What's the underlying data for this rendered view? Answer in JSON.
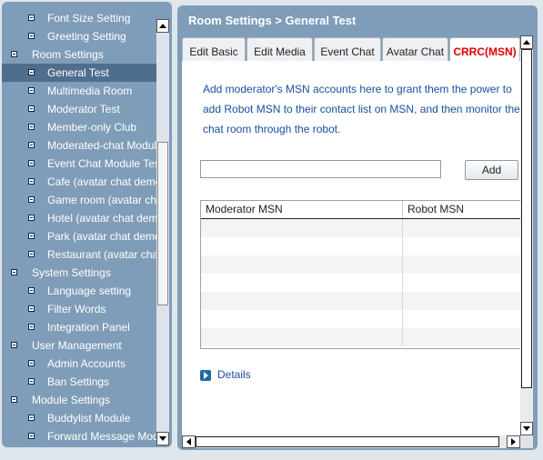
{
  "left_tree": {
    "items": [
      {
        "label": "Font Size Setting",
        "level": 1,
        "selected": false
      },
      {
        "label": "Greeting Setting",
        "level": 1,
        "selected": false
      },
      {
        "label": "Room Settings",
        "level": 0,
        "selected": false
      },
      {
        "label": "General Test",
        "level": 1,
        "selected": true
      },
      {
        "label": "Multimedia Room",
        "level": 1,
        "selected": false
      },
      {
        "label": "Moderator Test",
        "level": 1,
        "selected": false
      },
      {
        "label": "Member-only Club",
        "level": 1,
        "selected": false
      },
      {
        "label": "Moderated-chat Module",
        "level": 1,
        "selected": false
      },
      {
        "label": "Event Chat Module Test",
        "level": 1,
        "selected": false
      },
      {
        "label": "Cafe (avatar chat demo)",
        "level": 1,
        "selected": false
      },
      {
        "label": "Game room (avatar chat demo)",
        "level": 1,
        "selected": false
      },
      {
        "label": "Hotel (avatar chat demo)",
        "level": 1,
        "selected": false
      },
      {
        "label": "Park (avatar chat demo)",
        "level": 1,
        "selected": false
      },
      {
        "label": "Restaurant (avatar chat demo)",
        "level": 1,
        "selected": false
      },
      {
        "label": "System Settings",
        "level": 0,
        "selected": false
      },
      {
        "label": "Language setting",
        "level": 1,
        "selected": false
      },
      {
        "label": "Filter Words",
        "level": 1,
        "selected": false
      },
      {
        "label": "Integration Panel",
        "level": 1,
        "selected": false
      },
      {
        "label": "User Management",
        "level": 0,
        "selected": false
      },
      {
        "label": "Admin Accounts",
        "level": 1,
        "selected": false
      },
      {
        "label": "Ban Settings",
        "level": 1,
        "selected": false
      },
      {
        "label": "Module Settings",
        "level": 0,
        "selected": false
      },
      {
        "label": "Buddylist Module",
        "level": 1,
        "selected": false
      },
      {
        "label": "Forward Message Module",
        "level": 1,
        "selected": false
      }
    ]
  },
  "panel": {
    "title": "Room Settings > General Test"
  },
  "tabs": [
    {
      "label": "Edit Basic",
      "active": false
    },
    {
      "label": "Edit Media",
      "active": false
    },
    {
      "label": "Event Chat",
      "active": false
    },
    {
      "label": "Avatar Chat",
      "active": false
    },
    {
      "label": "CRRC(MSN)",
      "active": true
    }
  ],
  "content": {
    "description_lines": [
      "Add moderator's MSN accounts here to grant them the power to",
      "add Robot MSN to their contact list on MSN, and then monitor the",
      "chat room through the robot."
    ],
    "input_value": "",
    "add_button_label": "Add",
    "table": {
      "columns": [
        "Moderator MSN",
        "Robot MSN"
      ],
      "rows": [
        [
          "",
          ""
        ],
        [
          "",
          ""
        ],
        [
          "",
          ""
        ],
        [
          "",
          ""
        ],
        [
          "",
          ""
        ],
        [
          "",
          ""
        ],
        [
          "",
          ""
        ]
      ]
    },
    "details_label": "Details"
  },
  "colors": {
    "panel_bg": "#7f9db8",
    "selected_item": "#4f6d8c",
    "active_tab_text": "#e00000",
    "link_blue": "#1a4fa0"
  },
  "icons": {
    "tree_bullet": "tree-node-icon",
    "details": "play-arrow-icon"
  }
}
